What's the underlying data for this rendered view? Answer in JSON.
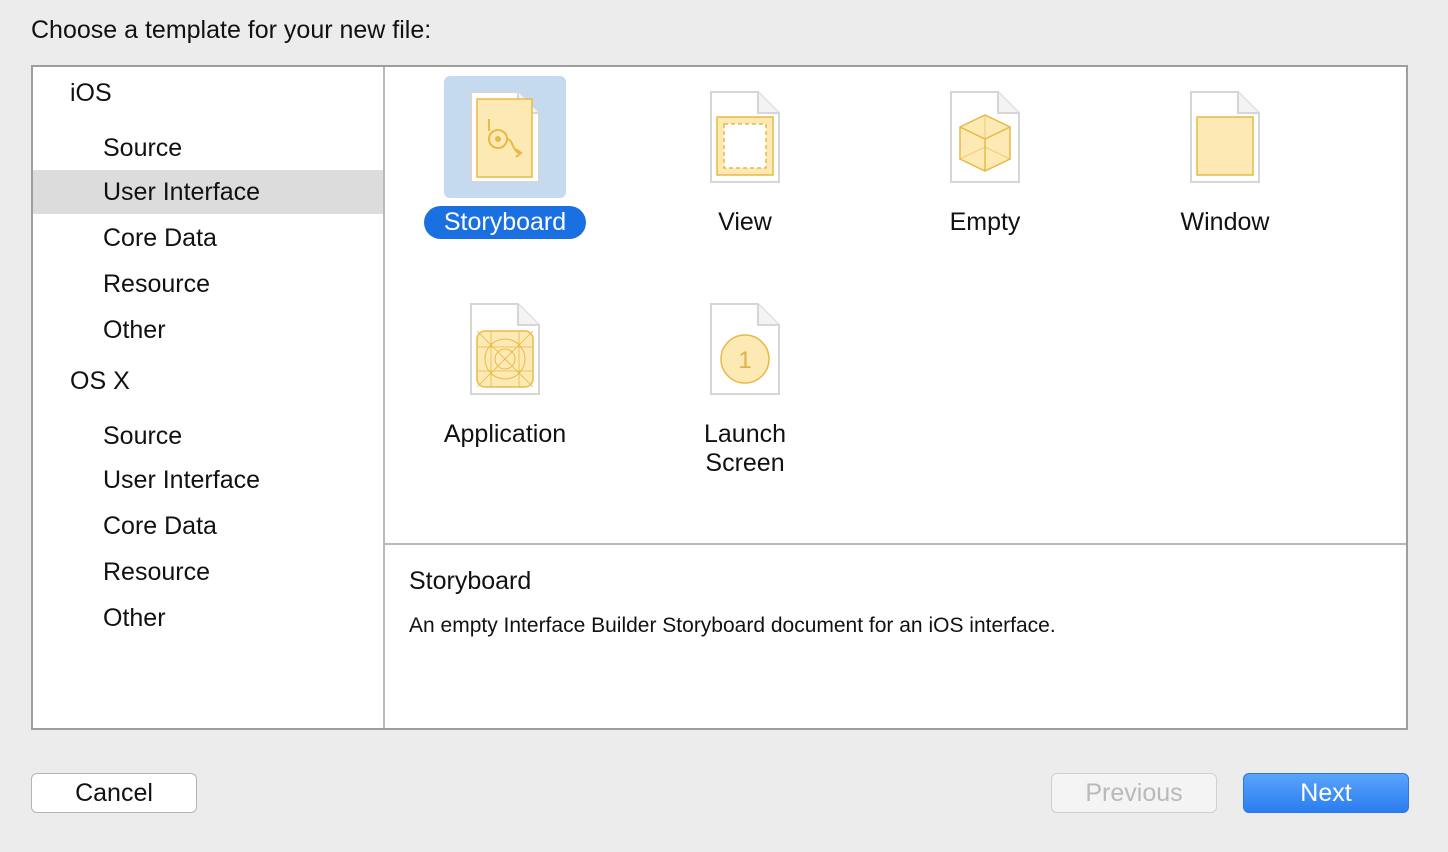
{
  "dialog": {
    "prompt": "Choose a template for your new file:"
  },
  "sidebar": {
    "sections": [
      {
        "title": "iOS",
        "items": [
          "Source",
          "User Interface",
          "Core Data",
          "Resource",
          "Other"
        ]
      },
      {
        "title": "OS X",
        "items": [
          "Source",
          "User Interface",
          "Core Data",
          "Resource",
          "Other"
        ]
      }
    ],
    "selected": "iOS / User Interface"
  },
  "templates": [
    {
      "label": "Storyboard",
      "icon": "storyboard-file-icon",
      "selected": true
    },
    {
      "label": "View",
      "icon": "view-file-icon"
    },
    {
      "label": "Empty",
      "icon": "empty-file-icon"
    },
    {
      "label": "Window",
      "icon": "window-file-icon"
    },
    {
      "label": "Application",
      "icon": "application-file-icon"
    },
    {
      "label": "Launch Screen",
      "icon": "launch-screen-file-icon",
      "badge": "1"
    }
  ],
  "description": {
    "title": "Storyboard",
    "text": "An empty Interface Builder Storyboard document for an iOS interface."
  },
  "buttons": {
    "cancel": "Cancel",
    "previous": "Previous",
    "next": "Next"
  },
  "colors": {
    "accent": "#1a6fe1",
    "selection_tile": "#c5d9ef",
    "icon_fill": "#fde9b4",
    "icon_stroke": "#e9b945"
  }
}
